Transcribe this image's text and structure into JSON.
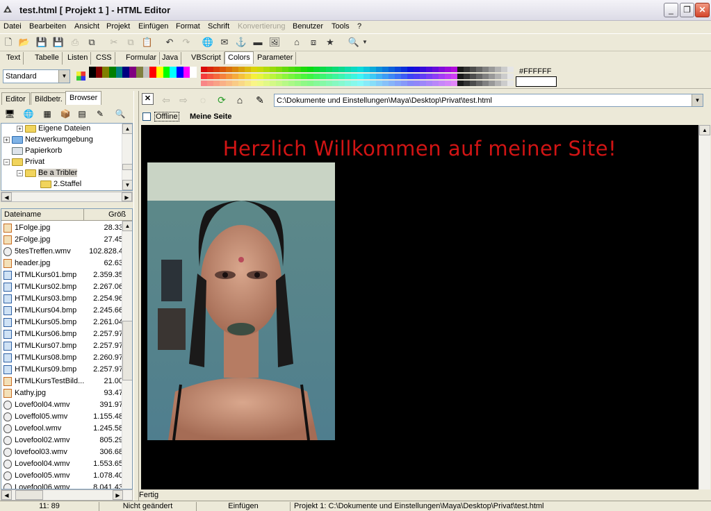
{
  "window": {
    "title": "test.html  [ Projekt 1 ] - HTML Editor"
  },
  "menu": {
    "items": [
      "Datei",
      "Bearbeiten",
      "Ansicht",
      "Projekt",
      "Einfügen",
      "Format",
      "Schrift",
      "Konvertierung",
      "Benutzer",
      "Tools",
      "?"
    ],
    "disabled": "Konvertierung"
  },
  "tabs": [
    "Text",
    "Tabelle",
    "Listen",
    "CSS",
    "Formular",
    "Java",
    "VBScript",
    "Colors",
    "Parameter"
  ],
  "active_tab": "Colors",
  "colorbar": {
    "preset": "Standard",
    "hex": "#FFFFFF"
  },
  "left_panel": {
    "tabs": [
      "Editor",
      "Bildbetr.",
      "Browser"
    ],
    "active_tab": "Browser",
    "tree": [
      "Eigene Dateien",
      "Netzwerkumgebung",
      "Papierkorb",
      "Privat",
      "Be a Tribler",
      "2.Staffel"
    ],
    "file_columns": [
      "Dateiname",
      "Größ"
    ],
    "files": [
      {
        "name": "1Folge.jpg",
        "size": "28.33",
        "type": "jpg"
      },
      {
        "name": "2Folge.jpg",
        "size": "27.45",
        "type": "jpg"
      },
      {
        "name": "5tesTreffen.wmv",
        "size": "102.828.4",
        "type": "wmv"
      },
      {
        "name": "header.jpg",
        "size": "62.63",
        "type": "jpg"
      },
      {
        "name": "HTMLKurs01.bmp",
        "size": "2.359.35",
        "type": "bmp"
      },
      {
        "name": "HTMLKurs02.bmp",
        "size": "2.267.06",
        "type": "bmp"
      },
      {
        "name": "HTMLKurs03.bmp",
        "size": "2.254.96",
        "type": "bmp"
      },
      {
        "name": "HTMLKurs04.bmp",
        "size": "2.245.66",
        "type": "bmp"
      },
      {
        "name": "HTMLKurs05.bmp",
        "size": "2.261.04",
        "type": "bmp"
      },
      {
        "name": "HTMLKurs06.bmp",
        "size": "2.257.97",
        "type": "bmp"
      },
      {
        "name": "HTMLKurs07.bmp",
        "size": "2.257.97",
        "type": "bmp"
      },
      {
        "name": "HTMLKurs08.bmp",
        "size": "2.260.97",
        "type": "bmp"
      },
      {
        "name": "HTMLKurs09.bmp",
        "size": "2.257.97",
        "type": "bmp"
      },
      {
        "name": "HTMLKursTestBild...",
        "size": "21.00",
        "type": "jpg"
      },
      {
        "name": "Kathy.jpg",
        "size": "93.47",
        "type": "jpg"
      },
      {
        "name": "Lovef0ol04.wmv",
        "size": "391.97",
        "type": "wmv"
      },
      {
        "name": "Loveffol05.wmv",
        "size": "1.155.48",
        "type": "wmv"
      },
      {
        "name": "Lovefool.wmv",
        "size": "1.245.58",
        "type": "wmv"
      },
      {
        "name": "Lovefool02.wmv",
        "size": "805.29",
        "type": "wmv"
      },
      {
        "name": "lovefool03.wmv",
        "size": "306.68",
        "type": "wmv"
      },
      {
        "name": "Lovefool04.wmv",
        "size": "1.553.65",
        "type": "wmv"
      },
      {
        "name": "Lovefool05.wmv",
        "size": "1.078.40",
        "type": "wmv"
      },
      {
        "name": "Lovefool06.wmv",
        "size": "8.041.43",
        "type": "wmv"
      }
    ]
  },
  "editor": {
    "path": "C:\\Dokumente und Einstellungen\\Maya\\Desktop\\Privat\\test.html",
    "offline_label": "Offline",
    "page_title": "Meine Seite",
    "heading": "Herzlich Willkommen auf meiner Site!",
    "heading_color": "#d11414",
    "background": "#000000",
    "loading_status": "Fertig"
  },
  "status": {
    "cursor": "11: 89",
    "modified": "Nicht geändert",
    "mode": "Einfügen",
    "project_path": "Projekt 1: C:\\Dokumente und Einstellungen\\Maya\\Desktop\\Privat\\test.html"
  }
}
